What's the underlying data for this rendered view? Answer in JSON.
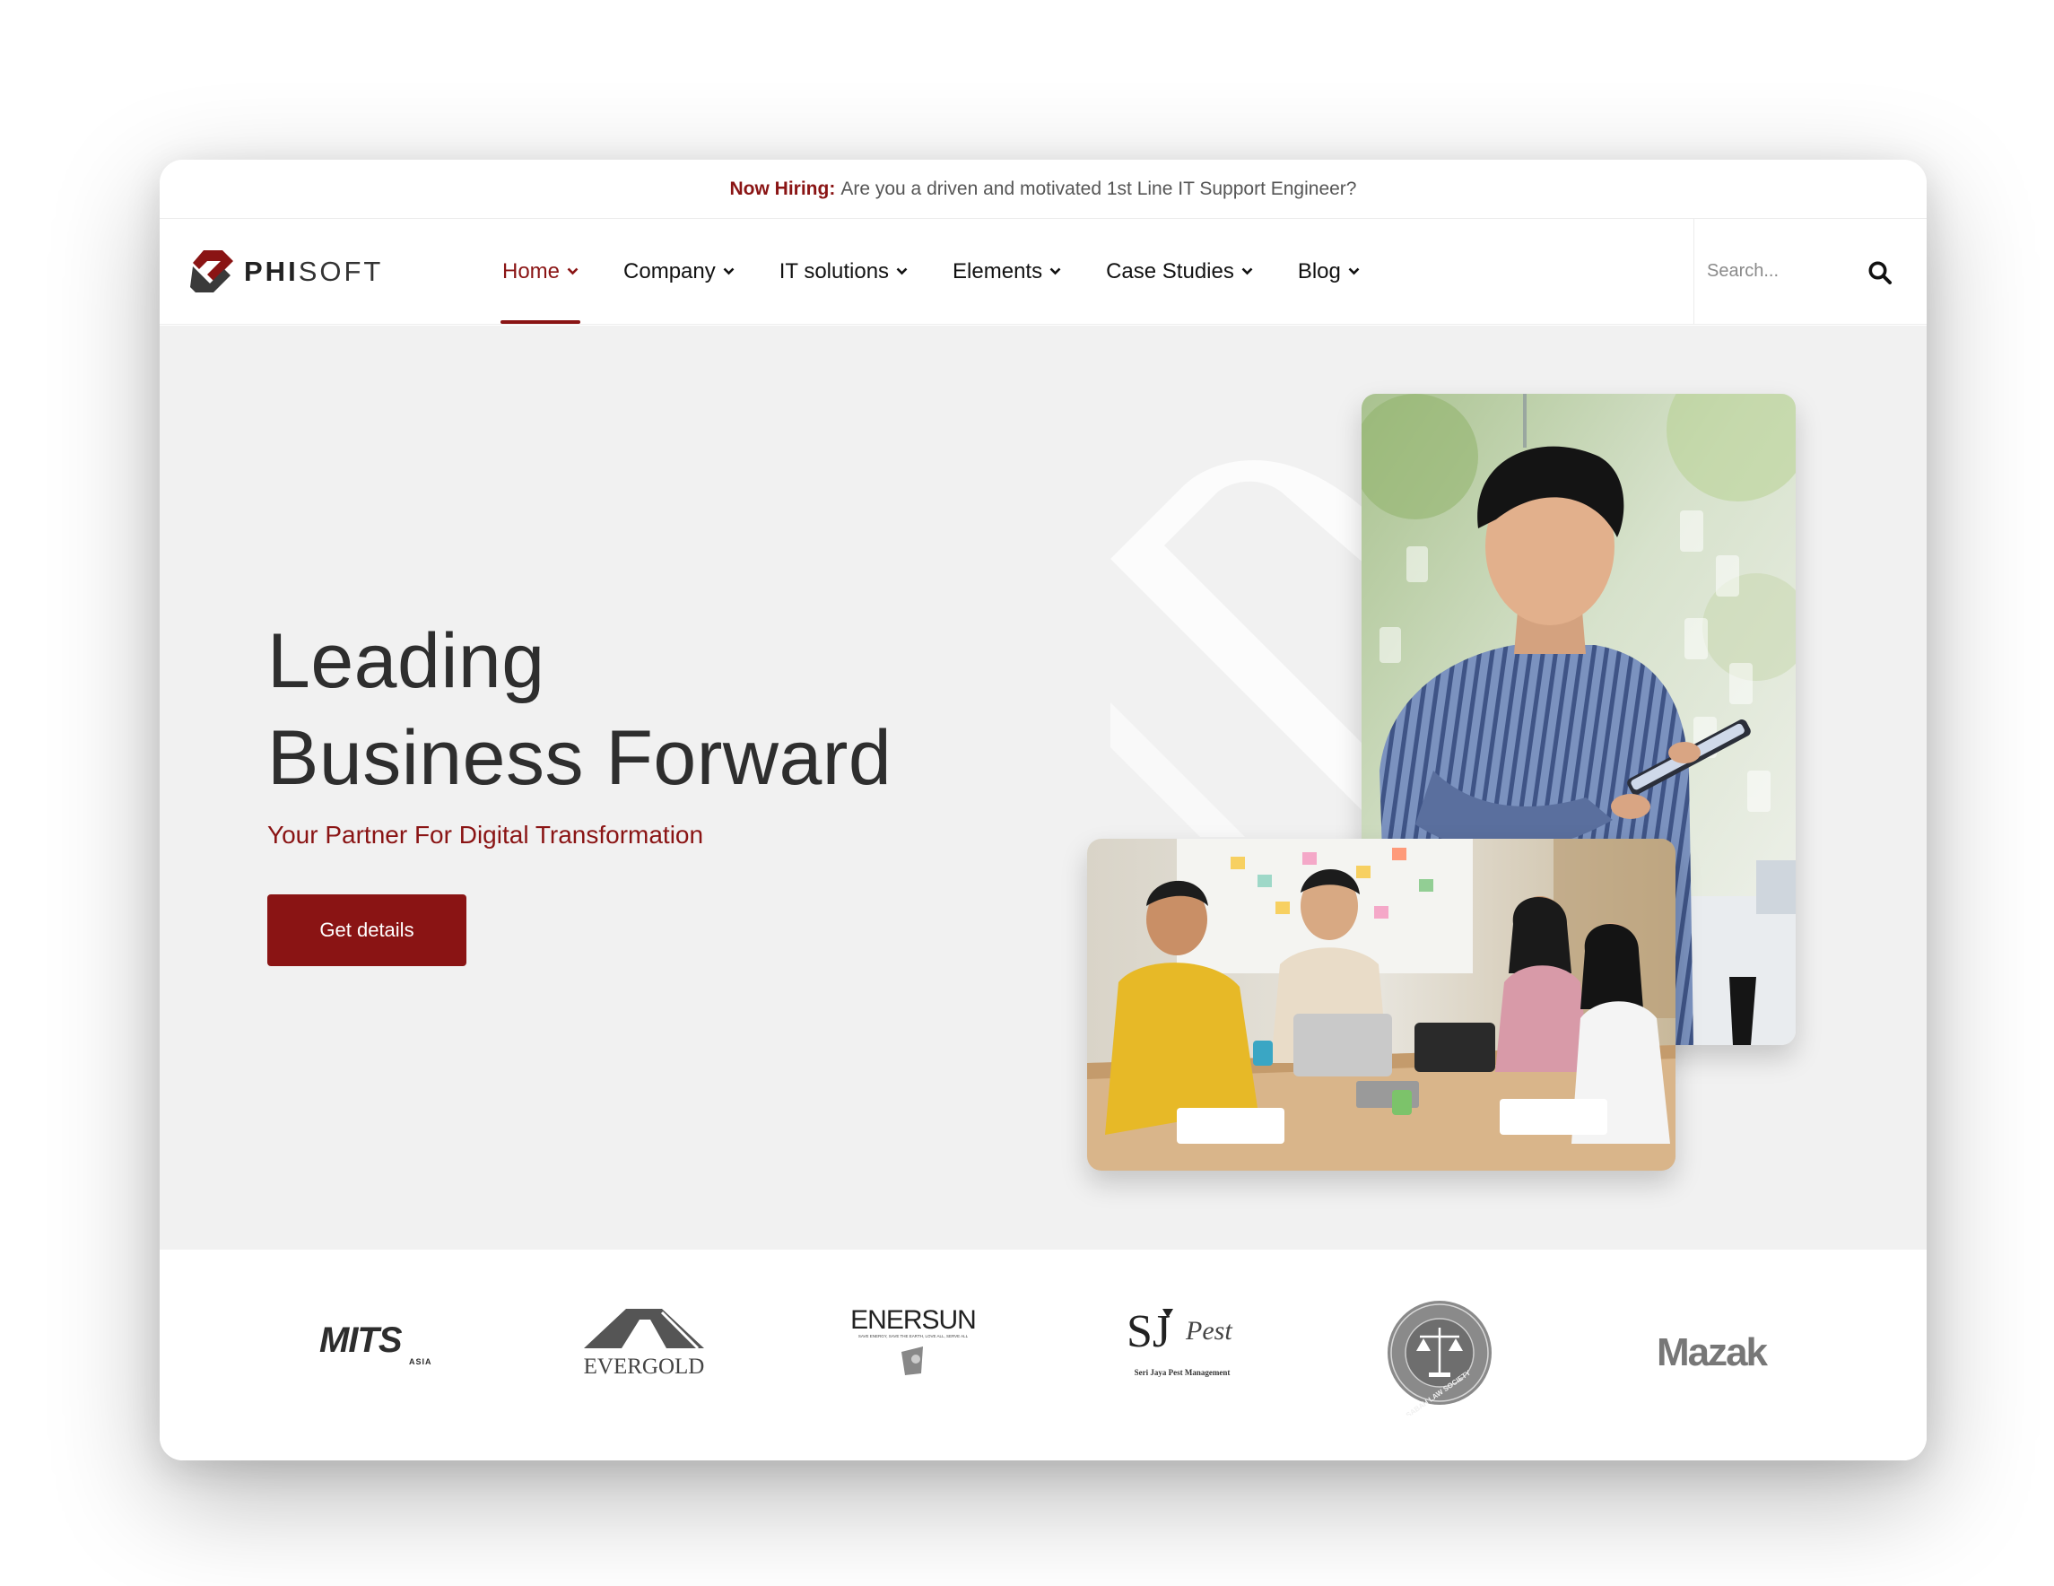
{
  "topbar": {
    "lead": "Now Hiring:",
    "message": "Are you a driven and motivated 1st Line IT Support Engineer?"
  },
  "brand": {
    "bold": "PHI",
    "light": "SOFT",
    "accent": "#8a1414"
  },
  "nav": [
    {
      "label": "Home",
      "active": true
    },
    {
      "label": "Company",
      "active": false
    },
    {
      "label": "IT solutions",
      "active": false
    },
    {
      "label": "Elements",
      "active": false
    },
    {
      "label": "Case Studies",
      "active": false
    },
    {
      "label": "Blog",
      "active": false
    }
  ],
  "search": {
    "placeholder": "Search...",
    "icon": "search-icon"
  },
  "hero": {
    "title_line1": "Leading",
    "title_line2": "Business Forward",
    "subtitle": "Your Partner For Digital Transformation",
    "cta": "Get details",
    "photo_a": "man-with-tablet-photo",
    "photo_b": "team-meeting-photo"
  },
  "clients": {
    "mits": {
      "main": "MITS",
      "sub": "ASIA"
    },
    "evergold": {
      "name": "EVERGOLD"
    },
    "enersun": {
      "name": "ENERSUN",
      "tagline": "SAVE ENERGY, SAVE THE EARTH, LOVE ALL, SERVE ALL"
    },
    "sjpest": {
      "mark": "SJ",
      "word": "Pest",
      "caption": "Seri Jaya Pest Management"
    },
    "sabah": {
      "name": "SABAH LAW SOCIETY"
    },
    "mazak": {
      "name": "Mazak"
    }
  }
}
